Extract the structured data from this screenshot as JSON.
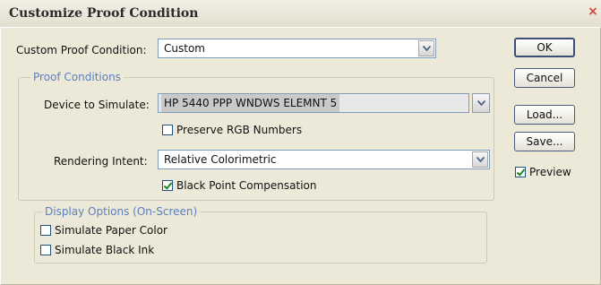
{
  "window": {
    "title": "Customize Proof Condition",
    "close_glyph": "×"
  },
  "custom_proof": {
    "label": "Custom Proof Condition:",
    "value": "Custom"
  },
  "proof_conditions": {
    "legend": "Proof Conditions",
    "device_label": "Device to Simulate:",
    "device_value": "HP 5440 PPP WNDWS ELEMNT 5",
    "preserve_rgb": {
      "label": "Preserve RGB Numbers",
      "checked": false
    },
    "rendering_label": "Rendering Intent:",
    "rendering_value": "Relative Colorimetric",
    "black_point": {
      "label": "Black Point Compensation",
      "checked": true
    }
  },
  "display_options": {
    "legend": "Display Options (On-Screen)",
    "simulate_paper": {
      "label": "Simulate Paper Color",
      "checked": false
    },
    "simulate_ink": {
      "label": "Simulate Black Ink",
      "checked": false
    }
  },
  "buttons": {
    "ok": "OK",
    "cancel": "Cancel",
    "load": "Load...",
    "save": "Save..."
  },
  "preview": {
    "label": "Preview",
    "checked": true
  },
  "colors": {
    "accent": "#5a7fc0",
    "face": "#ece9d8",
    "field_border": "#7f9db9"
  }
}
